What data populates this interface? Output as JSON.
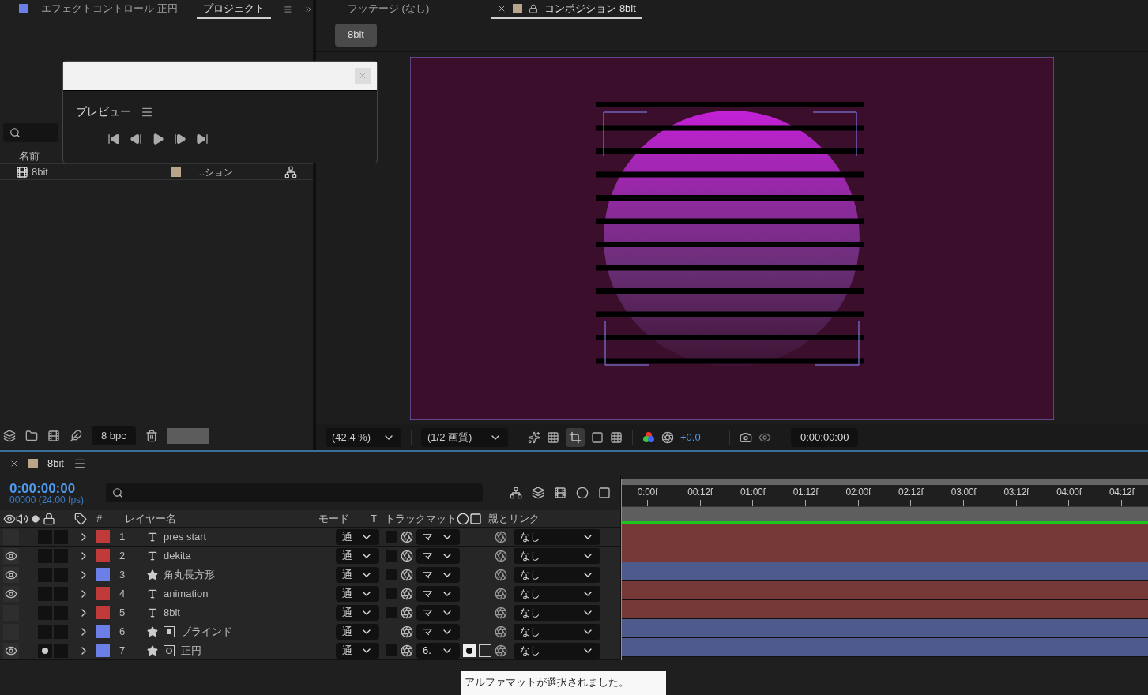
{
  "project_panel": {
    "tabs": [
      {
        "label": "エフェクトコントロール 正円",
        "selected": false,
        "color": "#6b7fe6"
      },
      {
        "label": "プロジェクト",
        "selected": true
      }
    ],
    "columns": [
      "名前"
    ],
    "items": [
      {
        "name": "8bit",
        "type": "...ション",
        "color": "#b8a58a"
      }
    ],
    "bpc": "8 bpc"
  },
  "preview_panel": {
    "title": "プレビュー"
  },
  "viewer": {
    "tabs": [
      {
        "label": "フッテージ (なし)",
        "selected": false
      },
      {
        "label": "コンポジション 8bit",
        "selected": true,
        "color": "#b8a58a"
      }
    ],
    "comp_button": "8bit",
    "zoom": "(42.4 %)",
    "quality": "(1/2 画質)",
    "exposure": "+0.0",
    "timecode": "0:00:00:00"
  },
  "timeline": {
    "tab": {
      "label": "8bit",
      "color": "#b8a58a"
    },
    "timecode": "0:00:00:00",
    "frames": "00000 (24.00 fps)",
    "ruler": [
      "0:00f",
      "00:12f",
      "01:00f",
      "01:12f",
      "02:00f",
      "02:12f",
      "03:00f",
      "03:12f",
      "04:00f",
      "04:12f"
    ],
    "headers": {
      "number": "#",
      "name": "レイヤー名",
      "mode": "モード",
      "t": "T",
      "matte": "トラックマット",
      "parent": "親とリンク"
    },
    "layers": [
      {
        "visible": false,
        "solo": false,
        "number": "1",
        "kind": "text",
        "name": "pres start",
        "mode": "通",
        "matte": "マ",
        "matte_box": true,
        "alpha": false,
        "parent": "なし",
        "color": "#c03a3a"
      },
      {
        "visible": true,
        "solo": false,
        "number": "2",
        "kind": "text",
        "name": "dekita",
        "mode": "通",
        "matte": "マ",
        "matte_box": true,
        "alpha": false,
        "parent": "なし",
        "color": "#c03a3a"
      },
      {
        "visible": true,
        "solo": false,
        "number": "3",
        "kind": "shape",
        "name": "角丸長方形",
        "mode": "通",
        "matte": "マ",
        "matte_box": true,
        "alpha": false,
        "parent": "なし",
        "color": "#6b7fe6"
      },
      {
        "visible": true,
        "solo": false,
        "number": "4",
        "kind": "text",
        "name": "animation",
        "mode": "通",
        "matte": "マ",
        "matte_box": true,
        "alpha": false,
        "parent": "なし",
        "color": "#c03a3a"
      },
      {
        "visible": false,
        "solo": false,
        "number": "5",
        "kind": "text",
        "name": "8bit",
        "mode": "通",
        "matte": "マ",
        "matte_box": true,
        "alpha": false,
        "parent": "なし",
        "color": "#c03a3a"
      },
      {
        "visible": false,
        "solo": false,
        "number": "6",
        "kind": "shape",
        "effect": {
          "kind": "blind"
        },
        "name": "ブラインド",
        "mode": "通",
        "matte": "マ",
        "matte_box": false,
        "alpha": false,
        "parent": "なし",
        "color": "#6b7fe6"
      },
      {
        "visible": true,
        "solo": true,
        "number": "7",
        "kind": "shape",
        "effect": {
          "kind": "circle"
        },
        "name": "正円",
        "mode": "通",
        "matte": "6.",
        "matte_box": true,
        "alpha": true,
        "parent": "なし",
        "color": "#6b7fe6"
      }
    ],
    "tooltip": "アルファマットが選択されました。"
  }
}
